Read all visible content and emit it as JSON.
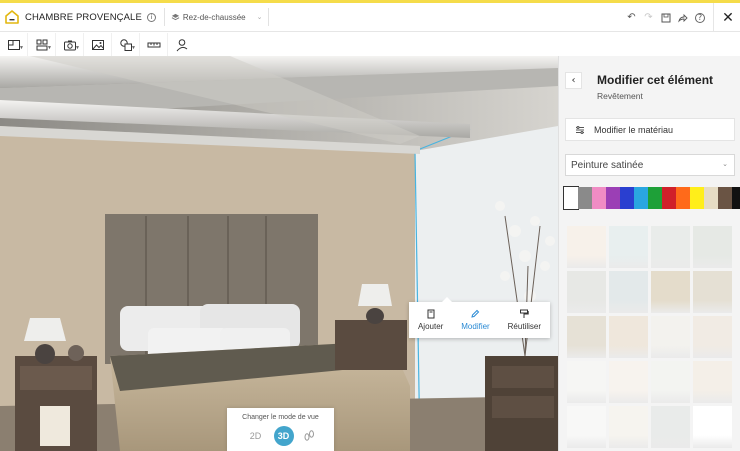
{
  "app": {
    "project_title": "CHAMBRE PROVENÇALE",
    "info_icon": "i",
    "floor_label": "Rez-de-chaussée",
    "icons": [
      "logo-house-icon",
      "info-icon",
      "stack-icon",
      "chevron-down-icon",
      "undo-icon",
      "redo-icon",
      "save-icon",
      "share-icon",
      "help-icon",
      "close-icon"
    ],
    "accent_color": "#f5dc4a"
  },
  "toolbar": {
    "tools": [
      "floor-plan-icon",
      "build-icon",
      "camera-icon",
      "picture-icon",
      "shapes-icon",
      "measure-icon",
      "assistant-icon"
    ]
  },
  "popup": {
    "items": [
      {
        "label": "Ajouter",
        "icon": "add-item-icon"
      },
      {
        "label": "Modifier",
        "icon": "pencil-icon"
      },
      {
        "label": "Réutiliser",
        "icon": "paint-roller-icon"
      }
    ],
    "active_color": "#2a8ad4"
  },
  "view_modes": {
    "label": "Changer le mode de vue",
    "modes": [
      "2D",
      "3D"
    ],
    "active": "3D",
    "walk_icon": "footsteps-icon",
    "active_color": "#43a5cc"
  },
  "panel": {
    "back_icon": "chevron-left-icon",
    "title": "Modifier cet élément",
    "subtitle": "Revêtement",
    "material_button": "Modifier le matériau",
    "material_icon": "sliders-icon",
    "finish_select": "Peinture satinée",
    "color_swatches": [
      "#ffffff",
      "#8a8a8a",
      "#f08cc4",
      "#9b3fb5",
      "#2a3fd0",
      "#2aa6e0",
      "#1ea038",
      "#d0202a",
      "#ff6a1a",
      "#ffee1a",
      "#e6dcc4",
      "#6a5444",
      "#111111"
    ],
    "selected_swatch": 0,
    "paint_tiles": [
      "#f7f1ea",
      "#e8efef",
      "#e9ecea",
      "#e6e9e5",
      "#e7e8e5",
      "#e3e9ea",
      "#e4dccb",
      "#e5e0d4",
      "#e6e1d6",
      "#efe7dc",
      "#f3f2ee",
      "#f1ebe4",
      "#f6f6f4",
      "#f7f3ee",
      "#f3f4f1",
      "#f4efe8",
      "#f8f8f7",
      "#f6f4ef",
      "#e9ebea",
      "#ffffff"
    ]
  }
}
